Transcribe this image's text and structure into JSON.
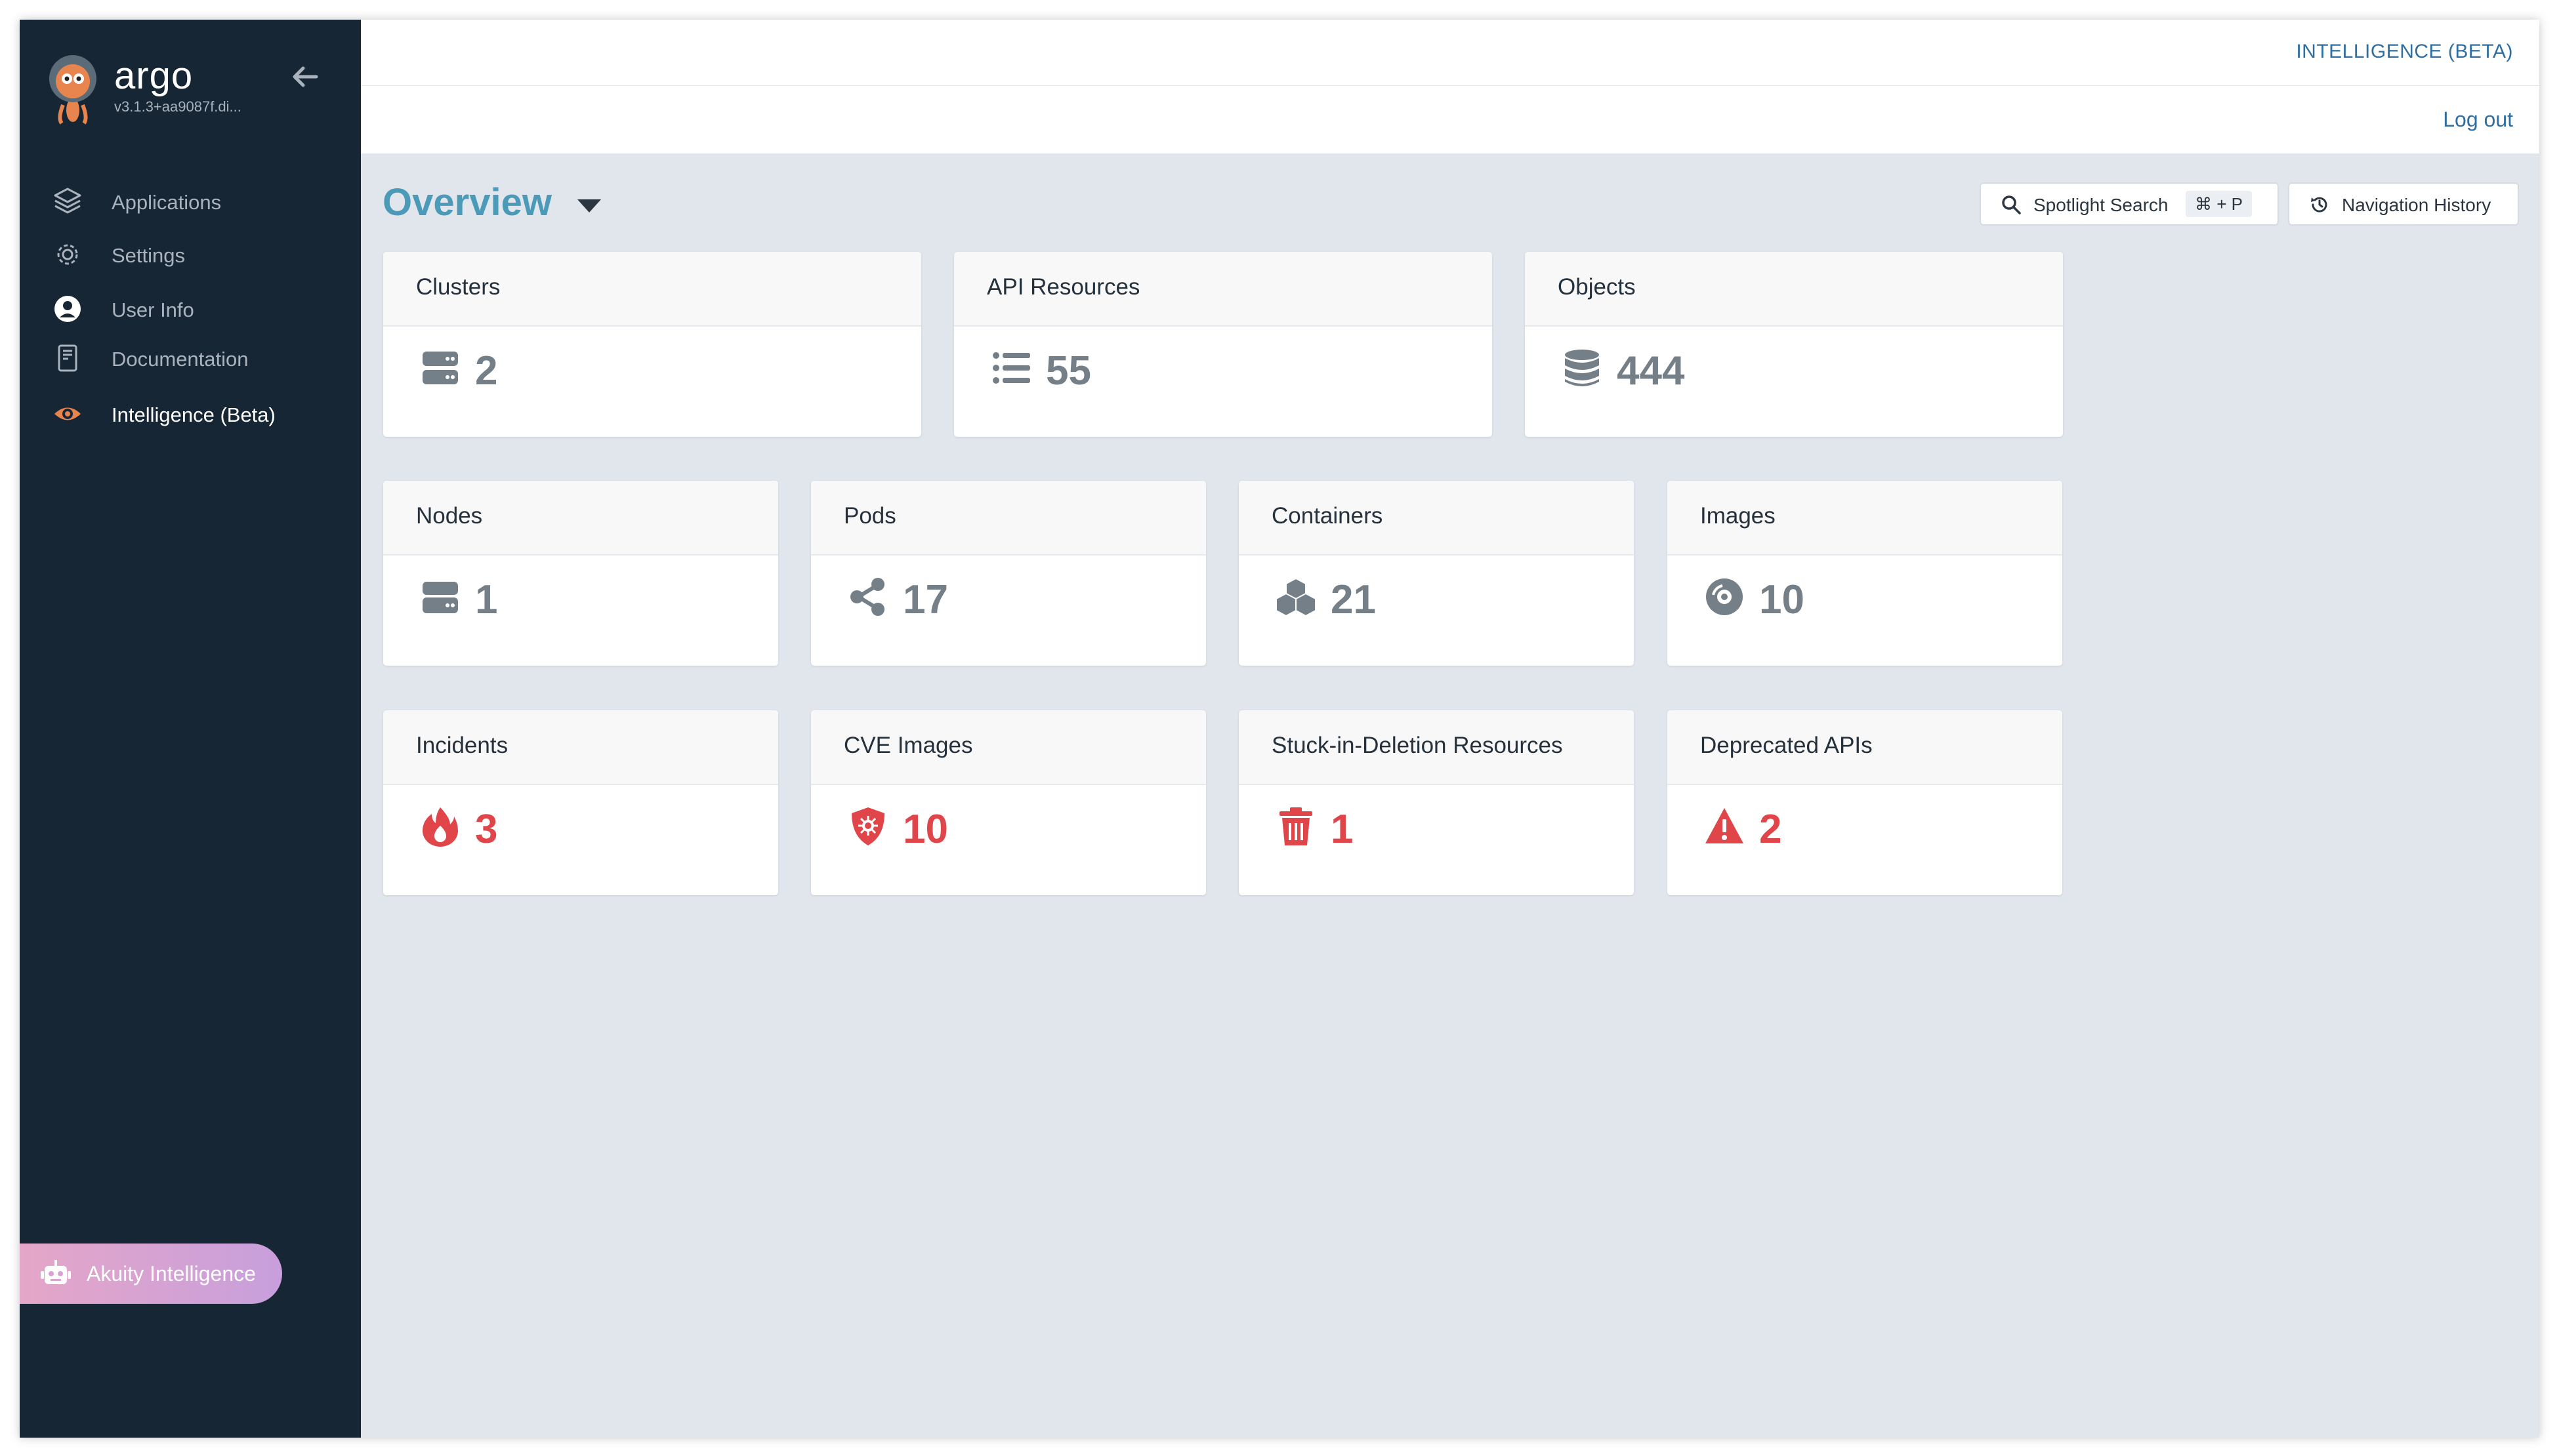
{
  "app": {
    "brand": "argo",
    "version": "v3.1.3+aa9087f.di..."
  },
  "sidebar": {
    "items": [
      {
        "label": "Applications",
        "icon": "layers-icon",
        "active": false
      },
      {
        "label": "Settings",
        "icon": "gear-icon",
        "active": false
      },
      {
        "label": "User Info",
        "icon": "user-circle-icon",
        "active": false
      },
      {
        "label": "Documentation",
        "icon": "book-icon",
        "active": false
      },
      {
        "label": "Intelligence (Beta)",
        "icon": "eye-icon",
        "active": true
      }
    ],
    "assistant_label": "Akuity Intelligence"
  },
  "topbar": {
    "intelligence_link": "INTELLIGENCE (BETA)",
    "logout": "Log out"
  },
  "header": {
    "title": "Overview",
    "spotlight_label": "Spotlight Search",
    "spotlight_shortcut": "⌘ + P",
    "nav_history_label": "Navigation History"
  },
  "cards": [
    {
      "title": "Clusters",
      "value": "2",
      "icon": "server-icon",
      "alert": false
    },
    {
      "title": "API Resources",
      "value": "55",
      "icon": "list-icon",
      "alert": false
    },
    {
      "title": "Objects",
      "value": "444",
      "icon": "database-icon",
      "alert": false
    },
    {
      "title": "Nodes",
      "value": "1",
      "icon": "hard-drive-icon",
      "alert": false
    },
    {
      "title": "Pods",
      "value": "17",
      "icon": "share-nodes-icon",
      "alert": false
    },
    {
      "title": "Containers",
      "value": "21",
      "icon": "cubes-icon",
      "alert": false
    },
    {
      "title": "Images",
      "value": "10",
      "icon": "compact-disc-icon",
      "alert": false
    },
    {
      "title": "Incidents",
      "value": "3",
      "icon": "fire-icon",
      "alert": true
    },
    {
      "title": "CVE Images",
      "value": "10",
      "icon": "shield-virus-icon",
      "alert": true
    },
    {
      "title": "Stuck-in-Deletion Resources",
      "value": "1",
      "icon": "trash-icon",
      "alert": true
    },
    {
      "title": "Deprecated APIs",
      "value": "2",
      "icon": "warning-triangle-icon",
      "alert": true
    }
  ],
  "colors": {
    "sidebar_bg": "#172634",
    "accent_title": "#4a9ab8",
    "link": "#2f6ea0",
    "alert": "#e0454a",
    "neutral_value": "#757f88"
  }
}
